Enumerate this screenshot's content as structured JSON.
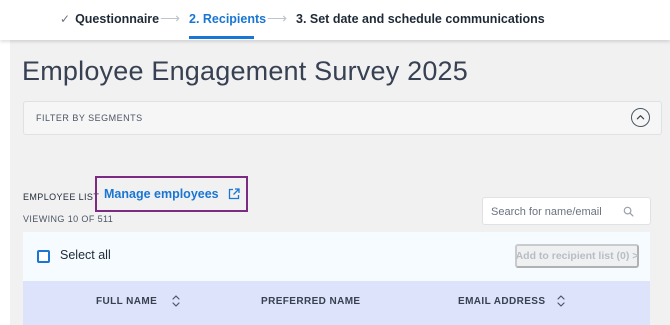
{
  "stepper": {
    "steps": [
      {
        "label": "Questionnaire",
        "state": "completed"
      },
      {
        "label": "2. Recipients",
        "state": "active"
      },
      {
        "label": "3. Set date and schedule communications",
        "state": "upcoming"
      }
    ],
    "separator_icon": "arrow-right-icon",
    "completed_icon": "check-icon"
  },
  "page": {
    "title": "Employee Engagement Survey 2025",
    "filter": {
      "label": "FILTER BY SEGMENTS",
      "toggle_icon": "chevron-up-circle-icon"
    },
    "employee_list": {
      "label": "EMPLOYEE LIST",
      "manage_link": "Manage employees",
      "manage_icon": "external-link-icon",
      "viewing": "VIEWING 10 OF 511"
    },
    "search": {
      "placeholder": "Search for name/email",
      "value": "",
      "icon": "search-icon"
    },
    "table": {
      "select_all_label": "Select all",
      "select_all_checked": false,
      "add_button_label": "Add to recipient list (0) >",
      "add_button_enabled": false,
      "columns": [
        {
          "label": "FULL NAME",
          "sortable": true
        },
        {
          "label": "PREFERRED NAME",
          "sortable": false
        },
        {
          "label": "EMAIL ADDRESS",
          "sortable": true
        }
      ]
    }
  },
  "colors": {
    "accent": "#1976d2",
    "highlight_border": "#7b2b82",
    "header_row": "#dde3fa",
    "table_bg": "#f5fbfe",
    "page_bg": "#f1f1f2"
  }
}
